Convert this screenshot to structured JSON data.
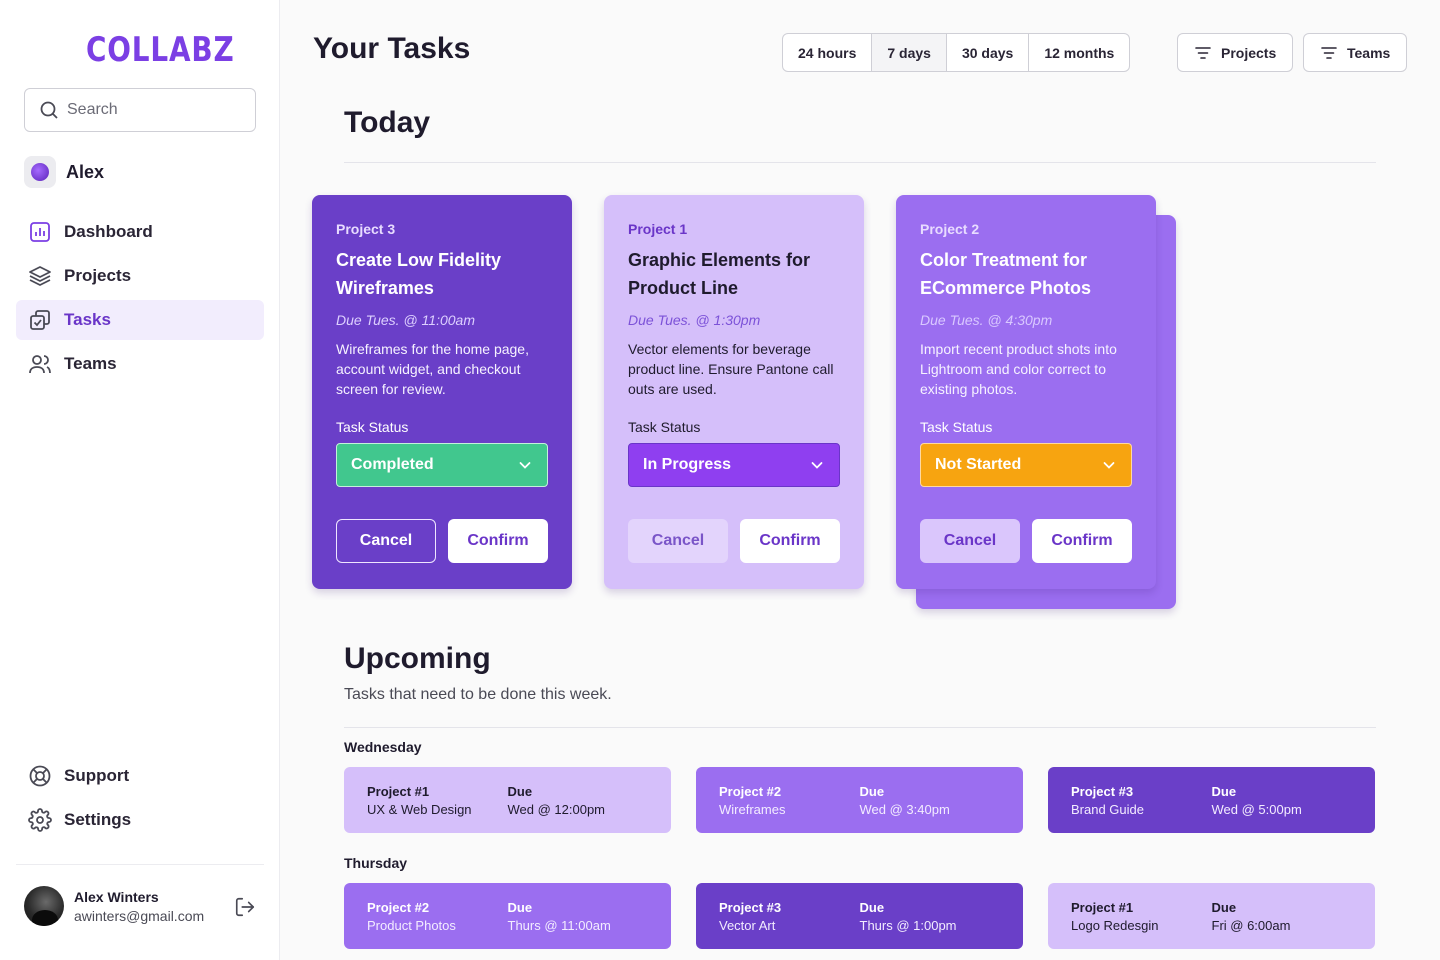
{
  "sidebar": {
    "logo": "COLLABZ",
    "search_placeholder": "Search",
    "user_name": "Alex",
    "nav": [
      {
        "label": "Dashboard",
        "icon": "bar-chart-icon"
      },
      {
        "label": "Projects",
        "icon": "layers-icon"
      },
      {
        "label": "Tasks",
        "icon": "tasks-icon",
        "active": true
      },
      {
        "label": "Teams",
        "icon": "users-icon"
      }
    ],
    "bottom_nav": [
      {
        "label": "Support",
        "icon": "lifebuoy-icon"
      },
      {
        "label": "Settings",
        "icon": "gear-icon"
      }
    ],
    "profile": {
      "name": "Alex Winters",
      "email": "awinters@gmail.com"
    }
  },
  "header": {
    "title": "Your Tasks",
    "ranges": [
      "24 hours",
      "7 days",
      "30 days",
      "12 months"
    ],
    "active_range": "7 days",
    "filters": [
      "Projects",
      "Teams"
    ]
  },
  "today": {
    "title": "Today",
    "status_label": "Task Status",
    "cancel_label": "Cancel",
    "confirm_label": "Confirm",
    "cards": [
      {
        "project": "Project 3",
        "title": "Create Low Fidelity Wireframes",
        "due": "Due Tues. @ 11:00am",
        "description": "Wireframes for the home page, account widget, and checkout screen for review.",
        "status": "Completed",
        "status_color": "#41c78e"
      },
      {
        "project": "Project 1",
        "title": "Graphic Elements for Product Line",
        "due": "Due Tues. @ 1:30pm",
        "description": "Vector elements for beverage product line. Ensure Pantone call outs are used.",
        "status": "In Progress",
        "status_color": "#8f3ff0"
      },
      {
        "project": "Project 2",
        "title": "Color Treatment for ECommerce Photos",
        "due": "Due Tues. @ 4:30pm",
        "description": "Import recent product shots into Lightroom and color correct to existing photos.",
        "status": "Not Started",
        "status_color": "#f7a410"
      }
    ]
  },
  "upcoming": {
    "title": "Upcoming",
    "subtitle": "Tasks that need to be done this week.",
    "due_label": "Due",
    "days": [
      {
        "day": "Wednesday",
        "items": [
          {
            "project": "Project #1",
            "name": "UX & Web Design",
            "due": "Wed @ 12:00pm"
          },
          {
            "project": "Project #2",
            "name": "Wireframes",
            "due": "Wed @ 3:40pm"
          },
          {
            "project": "Project #3",
            "name": "Brand Guide",
            "due": "Wed @ 5:00pm"
          }
        ]
      },
      {
        "day": "Thursday",
        "items": [
          {
            "project": "Project #2",
            "name": "Product Photos",
            "due": "Thurs @ 11:00am"
          },
          {
            "project": "Project #3",
            "name": "Vector Art",
            "due": "Thurs @ 1:00pm"
          },
          {
            "project": "Project #1",
            "name": "Logo Redesgin",
            "due": "Fri @ 6:00am"
          }
        ]
      }
    ]
  },
  "colors": {
    "accent": "#6a35c8",
    "light": "#d5bffa",
    "mid": "#9b6ef0",
    "dark": "#6a3fc8"
  }
}
